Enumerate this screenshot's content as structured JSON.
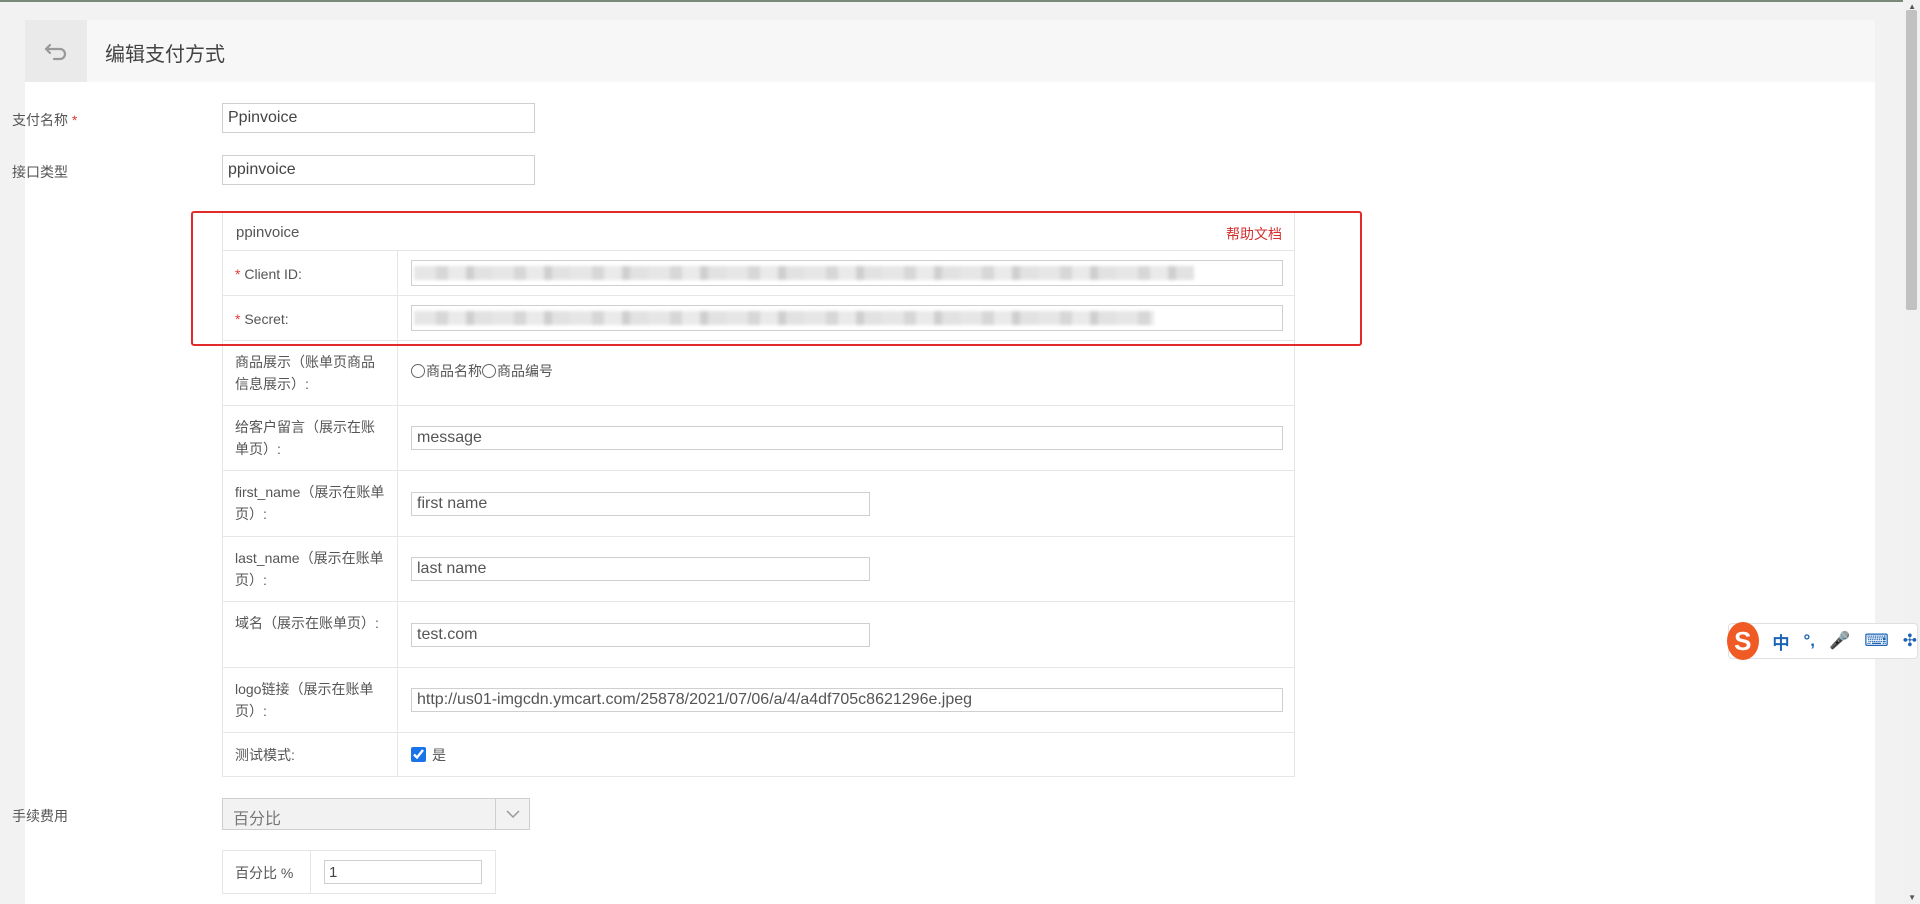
{
  "header": {
    "title": "编辑支付方式"
  },
  "form": {
    "pay_name_label": "支付名称",
    "required_mark": "*",
    "pay_name_value": "Ppinvoice",
    "api_type_label": "接口类型",
    "api_type_value": "ppinvoice"
  },
  "config": {
    "title": "ppinvoice",
    "help_link": "帮助文档",
    "client_id_label": "Client ID:",
    "secret_label": "Secret:",
    "product_display_label": "商品展示（账单页商品信息展示）:",
    "product_option_name": "商品名称",
    "product_option_sku": "商品编号",
    "message_label": "给客户留言（展示在账单页）:",
    "message_value": "message",
    "first_name_label": "first_name（展示在账单页）:",
    "first_name_value": "first name",
    "last_name_label": "last_name（展示在账单页）:",
    "last_name_value": "last name",
    "domain_label": "域名（展示在账单页）:",
    "domain_value": "test.com",
    "logo_label": "logo链接（展示在账单页）:",
    "logo_value": "http://us01-imgcdn.ymcart.com/25878/2021/07/06/a/4/a4df705c8621296e.jpeg",
    "test_mode_label": "测试模式:",
    "test_mode_option": "是",
    "test_mode_checked": true
  },
  "fee": {
    "label": "手续费用",
    "type_value": "百分比",
    "percent_label": "百分比 %",
    "percent_value": "1"
  },
  "ime": {
    "logo": "S",
    "items": [
      "中",
      "°,",
      "🎤",
      "⌨",
      "✣"
    ]
  }
}
